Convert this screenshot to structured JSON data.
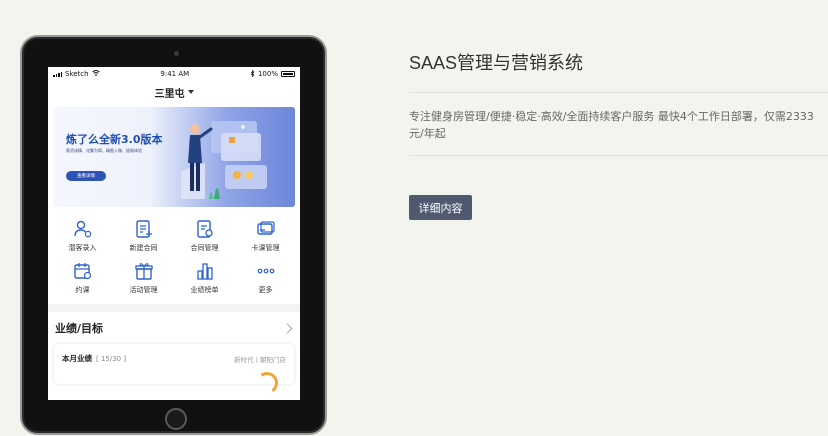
{
  "device": {
    "status_bar": {
      "carrier": "Sketch",
      "time": "9:41 AM",
      "battery": "100%"
    },
    "location": "三里屯",
    "banner": {
      "title": "炼了么全新3.0版本",
      "subtitle": "薪资成精、化繁为简、精细入微、极致体验",
      "button": "查看详情"
    },
    "grid": [
      {
        "label": "潜客录入",
        "icon": "add-user-icon"
      },
      {
        "label": "新建合同",
        "icon": "new-contract-icon"
      },
      {
        "label": "合同管理",
        "icon": "contract-manage-icon"
      },
      {
        "label": "卡课管理",
        "icon": "card-icon"
      },
      {
        "label": "约课",
        "icon": "calendar-clock-icon"
      },
      {
        "label": "活动管理",
        "icon": "gift-icon"
      },
      {
        "label": "业绩榜单",
        "icon": "bar-chart-icon"
      },
      {
        "label": "更多",
        "icon": "more-dots-icon"
      }
    ],
    "section": {
      "title": "业绩/目标"
    },
    "card": {
      "title": "本月业绩",
      "count": "[ 15/30 ]",
      "store": "新时代 | 朝阳门店"
    }
  },
  "panel": {
    "title": "SAAS管理与营销系统",
    "description": "专注健身房管理/便捷·稳定·高效/全面持续客户服务 最快4个工作日部署，仅需2333元/年起",
    "button_label": "详细内容"
  },
  "colors": {
    "accent": "#4f5a71",
    "icon_blue": "#2f63c9",
    "banner_blue": "#1f4fb6"
  }
}
